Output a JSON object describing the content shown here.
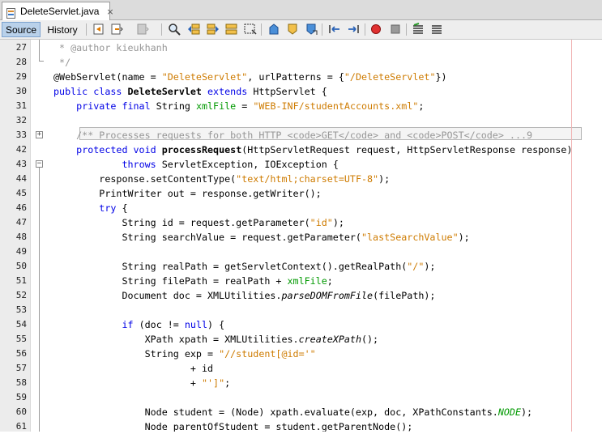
{
  "tab": {
    "title": "DeleteServlet.java",
    "close": "×"
  },
  "view_tabs": {
    "source": "Source",
    "history": "History"
  },
  "toolbar_icons": [
    "last-edit-icon",
    "back-history-icon",
    "forward-history-icon",
    "find-icon",
    "find-previous-icon",
    "find-next-icon",
    "toggle-highlight-icon",
    "rect-select-icon",
    "previous-bookmark-icon",
    "next-bookmark-icon",
    "toggle-bookmark-icon",
    "shift-left-icon",
    "shift-right-icon",
    "start-macro-icon",
    "stop-macro-icon",
    "comment-icon",
    "uncomment-icon"
  ],
  "colors": {
    "keyword": "#0000e6",
    "string": "#ce7b00",
    "comment": "#969696",
    "field": "#009900"
  },
  "lines": [
    {
      "n": "27",
      "segments": [
        {
          "t": " * @author kieukhanh",
          "c": "cm"
        }
      ]
    },
    {
      "n": "28",
      "segments": [
        {
          "t": " */",
          "c": "cm"
        }
      ]
    },
    {
      "n": "29",
      "segments": [
        {
          "t": "@WebServlet(name = "
        },
        {
          "t": "\"DeleteServlet\"",
          "c": "str"
        },
        {
          "t": ", urlPatterns = {"
        },
        {
          "t": "\"/DeleteServlet\"",
          "c": "str"
        },
        {
          "t": "})"
        }
      ]
    },
    {
      "n": "30",
      "segments": [
        {
          "t": "public class ",
          "c": "kw"
        },
        {
          "t": "DeleteServlet",
          "c": "bold"
        },
        {
          "t": " extends ",
          "c": "kw"
        },
        {
          "t": "HttpServlet {"
        }
      ]
    },
    {
      "n": "31",
      "segments": [
        {
          "t": "    "
        },
        {
          "t": "private final ",
          "c": "kw"
        },
        {
          "t": "String "
        },
        {
          "t": "xmlFile",
          "c": "fld"
        },
        {
          "t": " = "
        },
        {
          "t": "\"WEB-INF/studentAccounts.xml\"",
          "c": "str"
        },
        {
          "t": ";"
        }
      ]
    },
    {
      "n": "32",
      "segments": []
    },
    {
      "n": "33",
      "segments": [
        {
          "t": "    /** Processes requests for both HTTP <code>GET</code> and <code>POST</code> ...9",
          "c": "cm"
        }
      ]
    },
    {
      "n": "42",
      "segments": [
        {
          "t": "    "
        },
        {
          "t": "protected void ",
          "c": "kw"
        },
        {
          "t": "processRequest",
          "c": "bold"
        },
        {
          "t": "(HttpServletRequest request, HttpServletResponse response)"
        }
      ]
    },
    {
      "n": "43",
      "segments": [
        {
          "t": "            "
        },
        {
          "t": "throws ",
          "c": "kw"
        },
        {
          "t": "ServletException, IOException {"
        }
      ]
    },
    {
      "n": "44",
      "segments": [
        {
          "t": "        response.setContentType("
        },
        {
          "t": "\"text/html;charset=UTF-8\"",
          "c": "str"
        },
        {
          "t": ");"
        }
      ]
    },
    {
      "n": "45",
      "segments": [
        {
          "t": "        PrintWriter out = response.getWriter();"
        }
      ]
    },
    {
      "n": "46",
      "segments": [
        {
          "t": "        "
        },
        {
          "t": "try ",
          "c": "kw"
        },
        {
          "t": "{"
        }
      ]
    },
    {
      "n": "47",
      "segments": [
        {
          "t": "            String id = request.getParameter("
        },
        {
          "t": "\"id\"",
          "c": "str"
        },
        {
          "t": ");"
        }
      ]
    },
    {
      "n": "48",
      "segments": [
        {
          "t": "            String searchValue = request.getParameter("
        },
        {
          "t": "\"lastSearchValue\"",
          "c": "str"
        },
        {
          "t": ");"
        }
      ]
    },
    {
      "n": "49",
      "segments": []
    },
    {
      "n": "50",
      "segments": [
        {
          "t": "            String realPath = getServletContext().getRealPath("
        },
        {
          "t": "\"/\"",
          "c": "str"
        },
        {
          "t": ");"
        }
      ]
    },
    {
      "n": "51",
      "segments": [
        {
          "t": "            String filePath = realPath + "
        },
        {
          "t": "xmlFile",
          "c": "fld"
        },
        {
          "t": ";"
        }
      ]
    },
    {
      "n": "52",
      "segments": [
        {
          "t": "            Document doc = XMLUtilities."
        },
        {
          "t": "parseDOMFromFile",
          "c": "it"
        },
        {
          "t": "(filePath);"
        }
      ]
    },
    {
      "n": "53",
      "segments": []
    },
    {
      "n": "54",
      "segments": [
        {
          "t": "            "
        },
        {
          "t": "if ",
          "c": "kw"
        },
        {
          "t": "(doc != "
        },
        {
          "t": "null",
          "c": "kw"
        },
        {
          "t": ") {"
        }
      ]
    },
    {
      "n": "55",
      "segments": [
        {
          "t": "                XPath xpath = XMLUtilities."
        },
        {
          "t": "createXPath",
          "c": "it"
        },
        {
          "t": "();"
        }
      ]
    },
    {
      "n": "56",
      "segments": [
        {
          "t": "                String exp = "
        },
        {
          "t": "\"//student[@id='\"",
          "c": "str"
        }
      ]
    },
    {
      "n": "57",
      "segments": [
        {
          "t": "                        + id"
        }
      ]
    },
    {
      "n": "58",
      "segments": [
        {
          "t": "                        + "
        },
        {
          "t": "\"']\"",
          "c": "str"
        },
        {
          "t": ";"
        }
      ]
    },
    {
      "n": "59",
      "segments": []
    },
    {
      "n": "60",
      "segments": [
        {
          "t": "                Node student = (Node) xpath.evaluate(exp, doc, XPathConstants."
        },
        {
          "t": "NODE",
          "c": "const"
        },
        {
          "t": ");"
        }
      ]
    },
    {
      "n": "61",
      "segments": [
        {
          "t": "                Node parentOfStudent = student.getParentNode();"
        }
      ]
    }
  ]
}
